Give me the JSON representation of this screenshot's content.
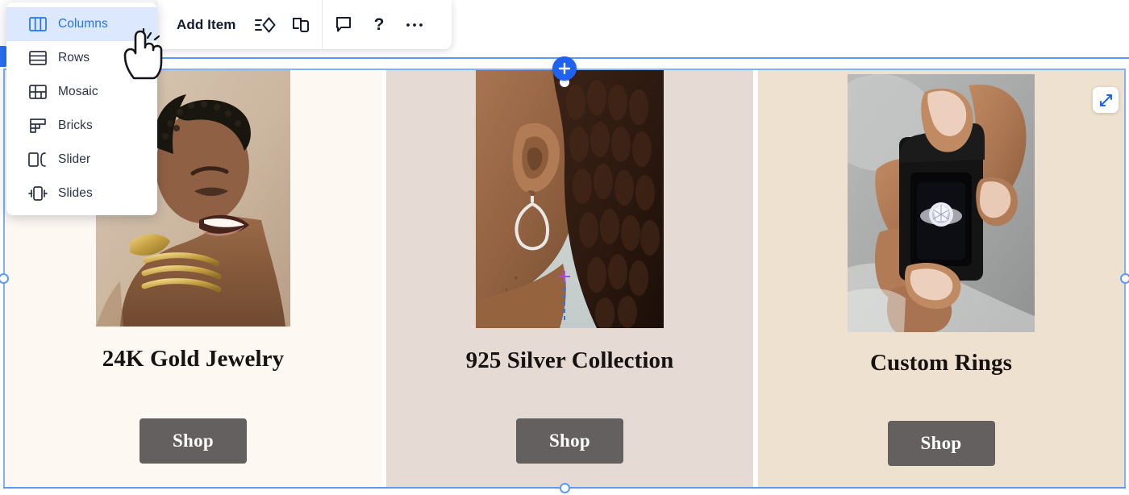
{
  "app": {
    "type": "website-editor-canvas"
  },
  "toolbar": {
    "add_item_label": "Add Item",
    "icons": [
      {
        "name": "ai-assist-icon",
        "title": "AI assist"
      },
      {
        "name": "duplicate-layout-icon",
        "title": "Duplicate layout"
      },
      {
        "name": "comment-icon",
        "title": "Comment"
      },
      {
        "name": "help-icon",
        "title": "Help"
      },
      {
        "name": "more-options-icon",
        "title": "More"
      }
    ]
  },
  "layout_dropdown": {
    "items": [
      {
        "label": "Columns",
        "icon": "columns-layout-icon",
        "selected": true
      },
      {
        "label": "Rows",
        "icon": "rows-layout-icon",
        "selected": false
      },
      {
        "label": "Mosaic",
        "icon": "mosaic-layout-icon",
        "selected": false
      },
      {
        "label": "Bricks",
        "icon": "bricks-layout-icon",
        "selected": false
      },
      {
        "label": "Slider",
        "icon": "slider-layout-icon",
        "selected": false
      },
      {
        "label": "Slides",
        "icon": "slides-layout-icon",
        "selected": false
      }
    ]
  },
  "canvas": {
    "add_section_icon": "plus-icon",
    "expand_icon": "expand-diagonal-icon",
    "selection_color": "#5b9bf8",
    "accent_color": "#1f62f0"
  },
  "cards": [
    {
      "title": "24K Gold Jewelry",
      "button_label": "Shop",
      "background": "#FDF8F2",
      "image_alt": "Woman smiling wearing gold choker and cuff"
    },
    {
      "title": "925 Silver Collection",
      "button_label": "Shop",
      "background": "#E5DAD4",
      "image_alt": "Close-up of ear with silver geometric earring"
    },
    {
      "title": "Custom Rings",
      "button_label": "Shop",
      "background": "#EFE1CF",
      "image_alt": "Hands holding a black ring box with diamond ring"
    }
  ]
}
